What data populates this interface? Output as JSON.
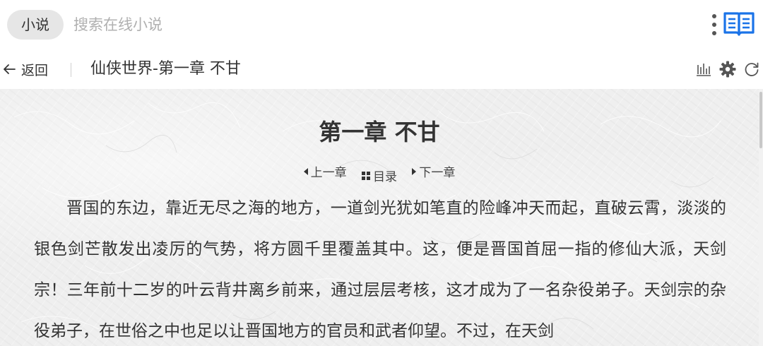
{
  "search": {
    "scope_label": "小说",
    "placeholder": "搜索在线小说"
  },
  "header": {
    "back_label": "返回",
    "chapter_title": "仙侠世界-第一章 不甘"
  },
  "chapter": {
    "heading": "第一章 不甘",
    "nav": {
      "prev": "上一章",
      "toc": "目录",
      "next": "下一章"
    },
    "paragraphs": [
      "晋国的东边，靠近无尽之海的地方，一道剑光犹如笔直的险峰冲天而起，直破云霄，淡淡的银色剑芒散发出凌厉的气势，将方圆千里覆盖其中。这，便是晋国首屈一指的修仙大派，天剑宗！三年前十二岁的叶云背井离乡前来，通过层层考核，这才成为了一名杂役弟子。天剑宗的杂役弟子，在世俗之中也足以让晋国地方的官员和武者仰望。不过，在天剑"
    ]
  },
  "icons": {
    "more": "more-vertical-icon",
    "book": "book-open-icon",
    "back": "arrow-left-icon",
    "stats": "bar-chart-icon",
    "settings": "gear-icon",
    "refresh": "refresh-icon",
    "prev": "triangle-left-icon",
    "toc": "grid-icon",
    "next": "triangle-right-icon"
  },
  "colors": {
    "accent": "#1a73e8",
    "paper": "#efefef",
    "text": "#333333"
  }
}
